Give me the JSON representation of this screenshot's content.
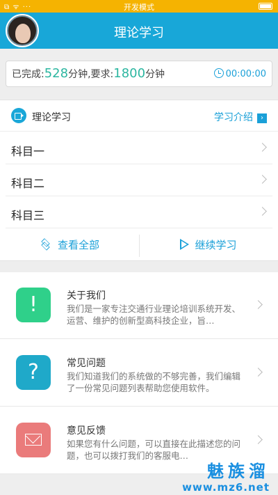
{
  "status_bar": {
    "left_icons": "⧉ ᯤ ···",
    "title": "开发模式"
  },
  "header": {
    "title": "理论学习"
  },
  "progress": {
    "prefix": "已完成:",
    "done_minutes": "528",
    "middle": "分钟,要求:",
    "required_minutes": "1800",
    "suffix": "分钟",
    "timer": "00:00:00"
  },
  "study": {
    "label": "理论学习",
    "intro_link": "学习介绍",
    "subjects": [
      "科目一",
      "科目二",
      "科目三"
    ],
    "view_all": "查看全部",
    "continue": "继续学习"
  },
  "info_items": [
    {
      "title": "关于我们",
      "desc": "我们是一家专注交通行业理论培训系统开发、运营、维护的创新型高科技企业，旨…",
      "icon": "exclamation-icon",
      "glyph": "!",
      "color": "#2fd08a"
    },
    {
      "title": "常见问题",
      "desc": "我们知道我们的系统做的不够完善，我们编辑了一份常见问题列表帮助您使用软件。",
      "icon": "question-icon",
      "glyph": "?",
      "color": "#1fa9c9"
    },
    {
      "title": "意见反馈",
      "desc": "如果您有什么问题，可以直接在此描述您的问题，也可以拨打我们的客服电…",
      "icon": "mail-icon",
      "color": "#ea7b7b"
    }
  ],
  "watermark": {
    "name": "魅族溜",
    "url": "www.mz6.net"
  }
}
